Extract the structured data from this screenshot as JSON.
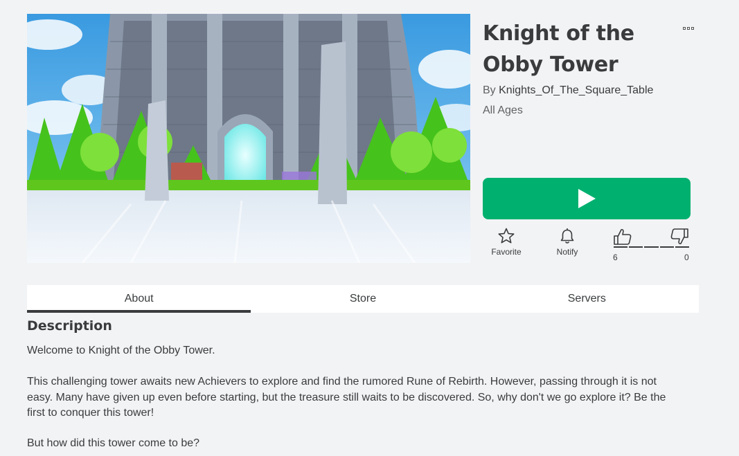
{
  "game": {
    "title": "Knight of the Obby Tower",
    "creator_prefix": "By ",
    "creator": "Knights_Of_The_Square_Table",
    "age_rating": "All Ages"
  },
  "actions": {
    "favorite_label": "Favorite",
    "notify_label": "Notify",
    "upvotes": "6",
    "downvotes": "0"
  },
  "tabs": [
    {
      "label": "About",
      "active": true
    },
    {
      "label": "Store",
      "active": false
    },
    {
      "label": "Servers",
      "active": false
    }
  ],
  "description": {
    "heading": "Description",
    "paragraphs": [
      "Welcome to Knight of the Obby Tower.",
      "This challenging tower awaits new Achievers to explore and find the rumored Rune of Rebirth. However, passing through it is not easy. Many have given up even before starting, but the treasure still waits to be discovered. So, why don't we go explore it? Be the first to conquer this tower!",
      "But how did this tower come to be?"
    ]
  },
  "icons": {
    "more": "more-options-icon",
    "play": "play-icon",
    "favorite": "star-icon",
    "notify": "bell-icon",
    "upvote": "thumbs-up-icon",
    "downvote": "thumbs-down-icon"
  },
  "colors": {
    "play_button": "#00b06f",
    "page_background": "#f2f3f5",
    "text": "#393b3d"
  }
}
